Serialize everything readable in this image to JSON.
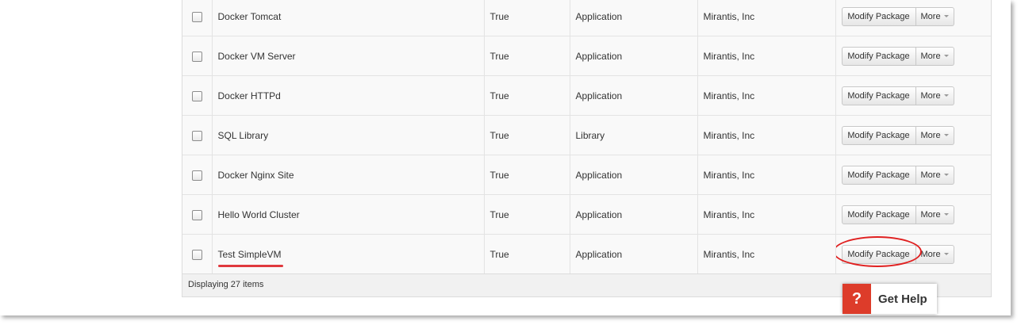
{
  "table": {
    "rows": [
      {
        "name": "Docker Tomcat",
        "active": "True",
        "type": "Application",
        "owner": "Mirantis, Inc",
        "modify_label": "Modify Package",
        "more_label": "More"
      },
      {
        "name": "Docker VM Server",
        "active": "True",
        "type": "Application",
        "owner": "Mirantis, Inc",
        "modify_label": "Modify Package",
        "more_label": "More"
      },
      {
        "name": "Docker HTTPd",
        "active": "True",
        "type": "Application",
        "owner": "Mirantis, Inc",
        "modify_label": "Modify Package",
        "more_label": "More"
      },
      {
        "name": "SQL Library",
        "active": "True",
        "type": "Library",
        "owner": "Mirantis, Inc",
        "modify_label": "Modify Package",
        "more_label": "More"
      },
      {
        "name": "Docker Nginx Site",
        "active": "True",
        "type": "Application",
        "owner": "Mirantis, Inc",
        "modify_label": "Modify Package",
        "more_label": "More"
      },
      {
        "name": "Hello World Cluster",
        "active": "True",
        "type": "Application",
        "owner": "Mirantis, Inc",
        "modify_label": "Modify Package",
        "more_label": "More"
      },
      {
        "name": "Test SimpleVM",
        "active": "True",
        "type": "Application",
        "owner": "Mirantis, Inc",
        "modify_label": "Modify Package",
        "more_label": "More"
      }
    ],
    "footer_text": "Displaying 27 items"
  },
  "help": {
    "icon_text": "?",
    "label": "Get Help"
  },
  "annotations": {
    "highlight_color": "#e02020",
    "underline_color": "#e0393e"
  }
}
